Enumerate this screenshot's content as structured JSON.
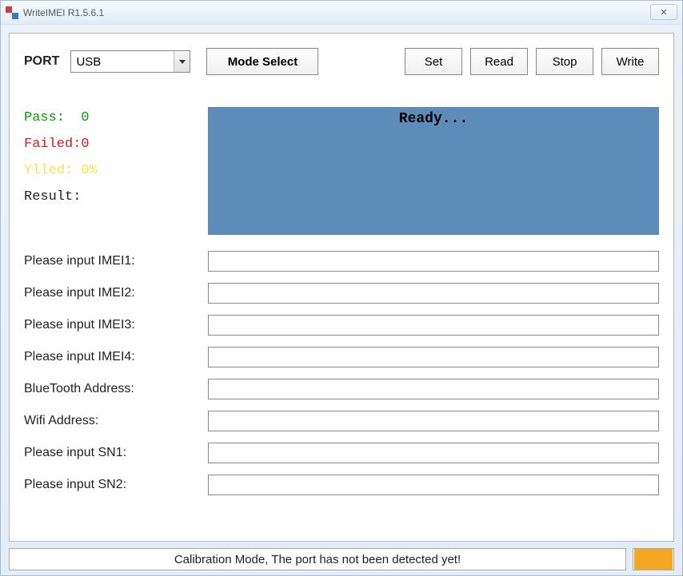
{
  "window": {
    "title": "WriteIMEI R1.5.6.1"
  },
  "toolbar": {
    "port_label": "PORT",
    "port_value": "USB",
    "mode_select": "Mode Select",
    "set": "Set",
    "read": "Read",
    "stop": "Stop",
    "write": "Write"
  },
  "stats": {
    "pass_label": "Pass:",
    "pass_value": "0",
    "failed_label": "Failed:",
    "failed_value": "0",
    "yield_label": "Ylled:",
    "yield_value": "0%",
    "result_label": "Result:"
  },
  "status": {
    "text": "Ready..."
  },
  "fields": {
    "imei1": {
      "label": "Please input IMEI1:",
      "value": ""
    },
    "imei2": {
      "label": "Please input IMEI2:",
      "value": ""
    },
    "imei3": {
      "label": "Please input IMEI3:",
      "value": ""
    },
    "imei4": {
      "label": "Please input IMEI4:",
      "value": ""
    },
    "bt": {
      "label": "BlueTooth Address:",
      "value": ""
    },
    "wifi": {
      "label": "Wifi Address:",
      "value": ""
    },
    "sn1": {
      "label": "Please input SN1:",
      "value": ""
    },
    "sn2": {
      "label": "Please input SN2:",
      "value": ""
    }
  },
  "footer": {
    "message": "Calibration Mode, The port has not been detected yet!"
  }
}
